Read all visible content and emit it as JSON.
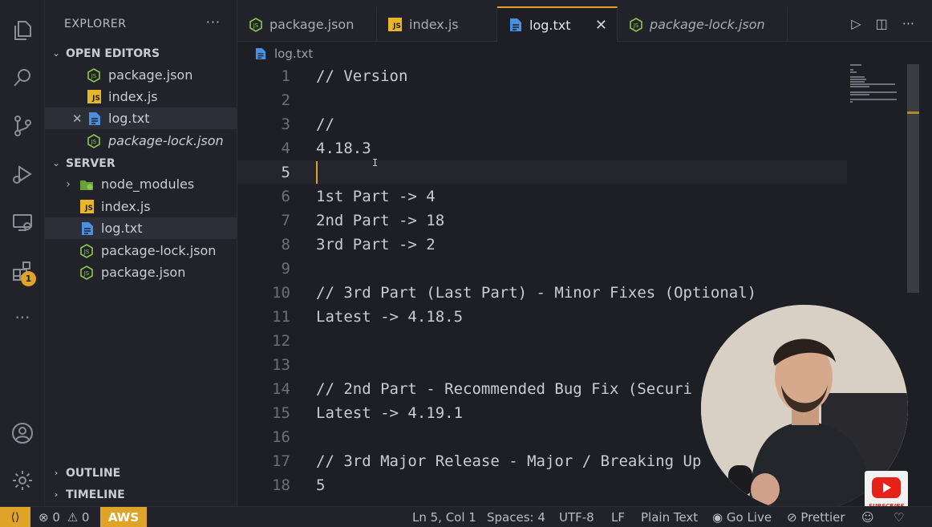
{
  "sidebar": {
    "title": "EXPLORER",
    "open_editors_label": "OPEN EDITORS",
    "open_editors": [
      {
        "label": "package.json",
        "icon": "nodejs-icon"
      },
      {
        "label": "index.js",
        "icon": "js-icon"
      },
      {
        "label": "log.txt",
        "icon": "file-text-icon"
      },
      {
        "label": "package-lock.json",
        "icon": "nodejs-icon"
      }
    ],
    "project_label": "SERVER",
    "project_items": [
      {
        "label": "node_modules",
        "icon": "folder-node-icon"
      },
      {
        "label": "index.js",
        "icon": "js-icon"
      },
      {
        "label": "log.txt",
        "icon": "file-text-icon"
      },
      {
        "label": "package-lock.json",
        "icon": "nodejs-icon"
      },
      {
        "label": "package.json",
        "icon": "nodejs-icon"
      }
    ],
    "outline_label": "OUTLINE",
    "timeline_label": "TIMELINE",
    "js_badge": "JS"
  },
  "activity": {
    "extensions_badge": "1"
  },
  "tabs": [
    {
      "label": "package.json",
      "icon": "nodejs-icon"
    },
    {
      "label": "index.js",
      "icon": "js-icon"
    },
    {
      "label": "log.txt",
      "icon": "file-text-icon",
      "active": true
    },
    {
      "label": "package-lock.json",
      "icon": "nodejs-icon"
    }
  ],
  "breadcrumb": "log.txt",
  "editor": {
    "lines": [
      {
        "n": "1",
        "text": "// Version"
      },
      {
        "n": "2",
        "text": ""
      },
      {
        "n": "3",
        "text": "//"
      },
      {
        "n": "4",
        "text": "4.18.3"
      },
      {
        "n": "5",
        "text": ""
      },
      {
        "n": "6",
        "text": "1st Part -> 4"
      },
      {
        "n": "7",
        "text": "2nd Part -> 18"
      },
      {
        "n": "8",
        "text": "3rd Part -> 2"
      },
      {
        "n": "9",
        "text": ""
      },
      {
        "n": "10",
        "text": "// 3rd Part (Last Part) - Minor Fixes (Optional)"
      },
      {
        "n": "11",
        "text": "Latest -> 4.18.5"
      },
      {
        "n": "12",
        "text": ""
      },
      {
        "n": "13",
        "text": ""
      },
      {
        "n": "14",
        "text": "// 2nd Part - Recommended Bug Fix (Securi"
      },
      {
        "n": "15",
        "text": "Latest -> 4.19.1"
      },
      {
        "n": "16",
        "text": ""
      },
      {
        "n": "17",
        "text": "// 3rd Major Release - Major / Breaking Up"
      },
      {
        "n": "18",
        "text": "5"
      }
    ],
    "current_line": 5
  },
  "status": {
    "errors": "0",
    "warnings": "0",
    "aws": "AWS",
    "position": "Ln 5, Col 1",
    "spaces": "Spaces: 4",
    "encoding": "UTF-8",
    "eol": "LF",
    "language": "Plain Text",
    "go_live": "Go Live",
    "prettier": "Prettier"
  },
  "overlay": {
    "subscribe_label": "SUBSCRIBE"
  },
  "colors": {
    "accent": "#e0a32a",
    "background": "#1e1f24",
    "sidebar": "#22232a",
    "node_green": "#8cc84b",
    "js_yellow": "#e8b62a",
    "file_blue": "#4a8fe0"
  }
}
